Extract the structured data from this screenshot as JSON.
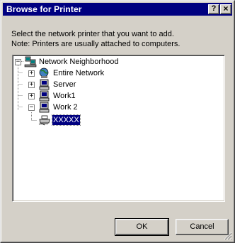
{
  "window": {
    "title": "Browse for Printer",
    "help_button": "?",
    "close_button": "×"
  },
  "prompt": {
    "line1": "Select the network printer that you want to add.",
    "line2": "Note: Printers are usually attached to computers."
  },
  "tree": {
    "root": {
      "label": "Network Neighborhood",
      "icon": "network-neighborhood-icon",
      "expanded": true
    },
    "children": [
      {
        "label": "Entire Network",
        "icon": "globe-icon",
        "expanded": false
      },
      {
        "label": "Server",
        "icon": "computer-icon",
        "expanded": false
      },
      {
        "label": "Work1",
        "icon": "computer-icon",
        "expanded": false
      },
      {
        "label": "Work 2",
        "icon": "computer-icon",
        "expanded": true
      }
    ],
    "printer": {
      "label": "XXXXX",
      "icon": "printer-icon",
      "selected": true
    }
  },
  "buttons": {
    "ok": "OK",
    "cancel": "Cancel"
  }
}
